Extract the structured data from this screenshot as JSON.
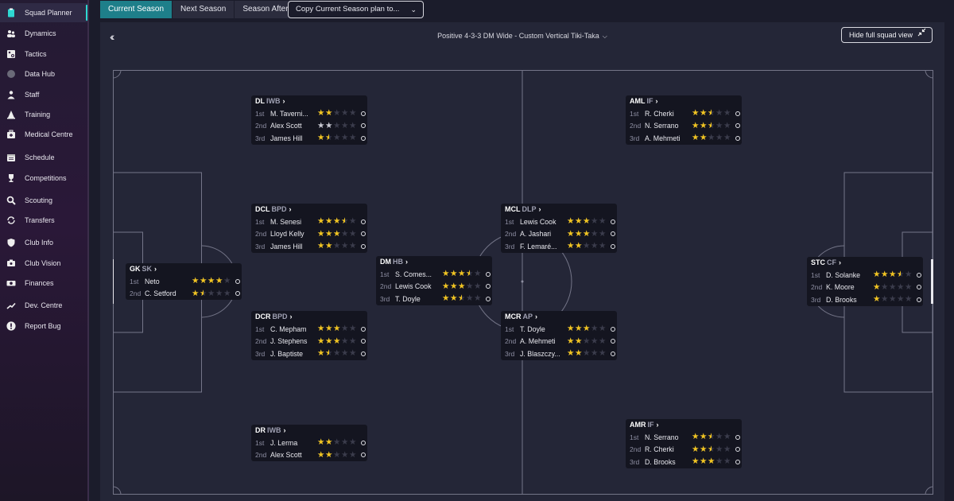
{
  "sidebar": {
    "items": [
      {
        "label": "Squad Planner",
        "icon": "clipboard-icon",
        "active": true
      },
      {
        "label": "Dynamics",
        "icon": "people-icon"
      },
      {
        "label": "Tactics",
        "icon": "tactics-board-icon"
      },
      {
        "label": "Data Hub",
        "icon": "circle-icon"
      },
      {
        "label": "Staff",
        "icon": "staff-icon"
      },
      {
        "label": "Training",
        "icon": "cone-icon"
      },
      {
        "label": "Medical Centre",
        "icon": "medical-bag-icon"
      },
      {
        "label": "Schedule",
        "icon": "calendar-icon"
      },
      {
        "label": "Competitions",
        "icon": "trophy-icon"
      },
      {
        "label": "Scouting",
        "icon": "magnifier-icon"
      },
      {
        "label": "Transfers",
        "icon": "transfer-arrows-icon"
      },
      {
        "label": "Club Info",
        "icon": "shield-icon"
      },
      {
        "label": "Club Vision",
        "icon": "vision-icon"
      },
      {
        "label": "Finances",
        "icon": "money-icon"
      },
      {
        "label": "Dev. Centre",
        "icon": "growth-icon"
      },
      {
        "label": "Report Bug",
        "icon": "exclamation-icon"
      }
    ]
  },
  "topbar": {
    "tabs": [
      {
        "label": "Current Season",
        "active": true
      },
      {
        "label": "Next Season"
      },
      {
        "label": "Season After"
      }
    ],
    "copy_dropdown": "Copy Current Season plan to..."
  },
  "main": {
    "tactic_title": "Positive 4-3-3 DM Wide - Custom Vertical Tiki-Taka",
    "hide_button": "Hide full squad view"
  },
  "positions": [
    {
      "id": "dl",
      "pos": "DL",
      "role": "IWB",
      "players": [
        {
          "rank": "1st",
          "name": "M. Taverni...",
          "stars": 2
        },
        {
          "rank": "2nd",
          "name": "Alex Scott",
          "stars": 2,
          "style": "silver"
        },
        {
          "rank": "3rd",
          "name": "James Hill",
          "stars": 1.5
        }
      ]
    },
    {
      "id": "aml",
      "pos": "AML",
      "role": "IF",
      "players": [
        {
          "rank": "1st",
          "name": "R. Cherki",
          "stars": 2.5
        },
        {
          "rank": "2nd",
          "name": "N. Serrano",
          "stars": 2.5
        },
        {
          "rank": "3rd",
          "name": "A. Mehmeti",
          "stars": 2
        }
      ]
    },
    {
      "id": "dcl",
      "pos": "DCL",
      "role": "BPD",
      "players": [
        {
          "rank": "1st",
          "name": "M. Senesi",
          "stars": 3.5
        },
        {
          "rank": "2nd",
          "name": "Lloyd Kelly",
          "stars": 3
        },
        {
          "rank": "3rd",
          "name": "James Hill",
          "stars": 2
        }
      ]
    },
    {
      "id": "mcl",
      "pos": "MCL",
      "role": "DLP",
      "players": [
        {
          "rank": "1st",
          "name": "Lewis Cook",
          "stars": 3
        },
        {
          "rank": "2nd",
          "name": "A. Jashari",
          "stars": 3
        },
        {
          "rank": "3rd",
          "name": "F. Lemaré...",
          "stars": 2
        }
      ]
    },
    {
      "id": "gk",
      "pos": "GK",
      "role": "SK",
      "players": [
        {
          "rank": "1st",
          "name": "Neto",
          "stars": 4
        },
        {
          "rank": "2nd",
          "name": "C. Setford",
          "stars": 1.5
        }
      ]
    },
    {
      "id": "dm",
      "pos": "DM",
      "role": "HB",
      "players": [
        {
          "rank": "1st",
          "name": "S. Comes...",
          "stars": 3.5
        },
        {
          "rank": "2nd",
          "name": "Lewis Cook",
          "stars": 3
        },
        {
          "rank": "3rd",
          "name": "T. Doyle",
          "stars": 2.5
        }
      ]
    },
    {
      "id": "stc",
      "pos": "STC",
      "role": "CF",
      "players": [
        {
          "rank": "1st",
          "name": "D. Solanke",
          "stars": 3.5
        },
        {
          "rank": "2nd",
          "name": "K. Moore",
          "stars": 1
        },
        {
          "rank": "3rd",
          "name": "D. Brooks",
          "stars": 1
        }
      ]
    },
    {
      "id": "dcr",
      "pos": "DCR",
      "role": "BPD",
      "players": [
        {
          "rank": "1st",
          "name": "C. Mepham",
          "stars": 3
        },
        {
          "rank": "2nd",
          "name": "J. Stephens",
          "stars": 3
        },
        {
          "rank": "3rd",
          "name": "J. Baptiste",
          "stars": 1.5
        }
      ]
    },
    {
      "id": "mcr",
      "pos": "MCR",
      "role": "AP",
      "players": [
        {
          "rank": "1st",
          "name": "T. Doyle",
          "stars": 3
        },
        {
          "rank": "2nd",
          "name": "A. Mehmeti",
          "stars": 2
        },
        {
          "rank": "3rd",
          "name": "J. Blaszczy...",
          "stars": 2
        }
      ]
    },
    {
      "id": "dr",
      "pos": "DR",
      "role": "IWB",
      "players": [
        {
          "rank": "1st",
          "name": "J. Lerma",
          "stars": 2
        },
        {
          "rank": "2nd",
          "name": "Alex Scott",
          "stars": 2
        }
      ]
    },
    {
      "id": "amr",
      "pos": "AMR",
      "role": "IF",
      "players": [
        {
          "rank": "1st",
          "name": "N. Serrano",
          "stars": 2.5
        },
        {
          "rank": "2nd",
          "name": "R. Cherki",
          "stars": 2.5
        },
        {
          "rank": "3rd",
          "name": "D. Brooks",
          "stars": 3
        }
      ]
    }
  ],
  "colors": {
    "accent": "#2ed8d2",
    "active_tab": "#1e7f8a",
    "star_gold": "#f2c521",
    "star_silver": "#c9cad3",
    "pitch": "#242637",
    "card": "#141520"
  }
}
